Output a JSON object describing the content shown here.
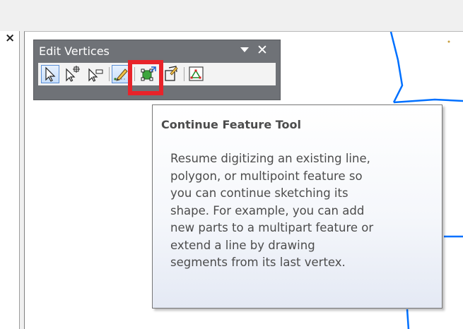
{
  "toolbar": {
    "title": "Edit Vertices",
    "close_glyph": "✕",
    "tools": [
      {
        "name": "edit-vertices-pointer",
        "icon": "arrow-select-icon"
      },
      {
        "name": "add-vertex",
        "icon": "add-vertex-icon"
      },
      {
        "name": "delete-vertex",
        "icon": "delete-vertex-icon"
      },
      {
        "name": "continue-feature-tool",
        "icon": "pencil-icon",
        "selected": true
      },
      {
        "name": "reshape-feature",
        "icon": "reshape-icon"
      },
      {
        "name": "trim-tool",
        "icon": "trim-icon"
      },
      {
        "name": "sketch-properties",
        "icon": "sketch-properties-icon"
      }
    ]
  },
  "left_panel": {
    "close_glyph": "×"
  },
  "tooltip": {
    "title": "Continue Feature Tool",
    "body_lines": [
      "Resume digitizing an existing line,",
      "polygon, or multipoint feature so",
      "you can continue sketching its",
      "shape. For example, you can add",
      "new parts to a multipart feature or",
      "extend a line by drawing",
      "segments from its last vertex."
    ]
  },
  "colors": {
    "highlight": "#e8232a",
    "map_line": "#0070ff",
    "toolbar_bg": "#6f7277",
    "tooltip_text": "#4c4c4c"
  }
}
